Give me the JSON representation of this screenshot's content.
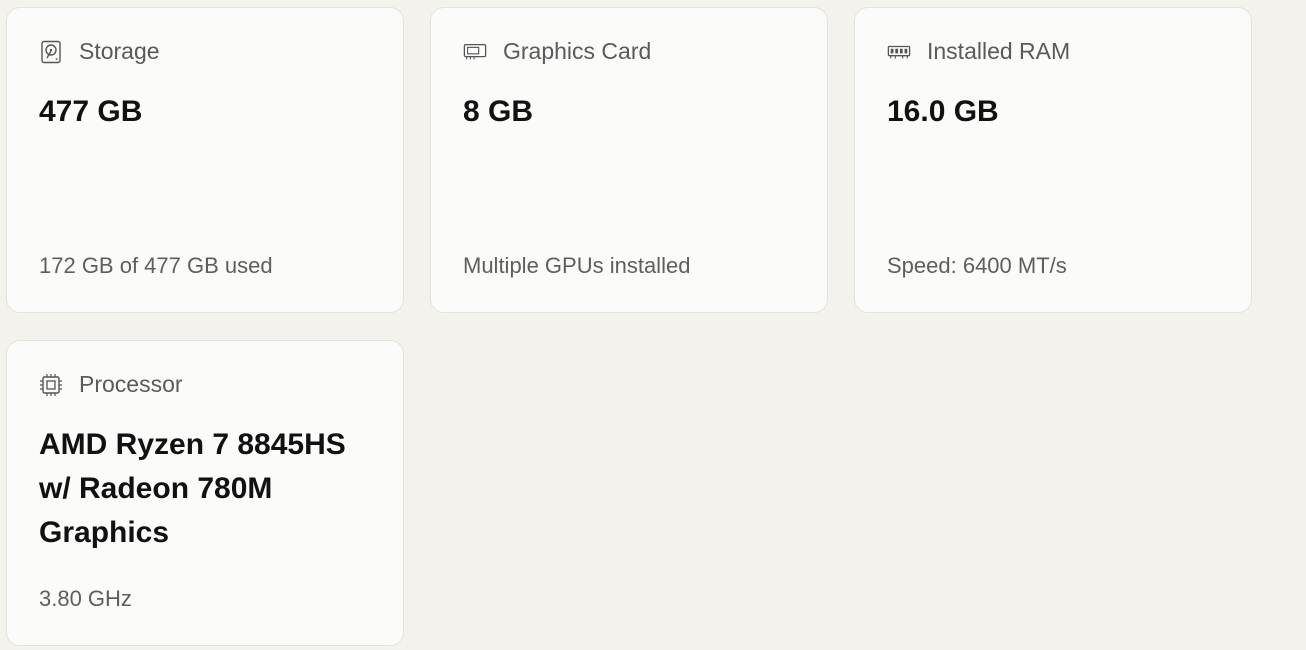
{
  "cards": [
    {
      "icon": "hard-drive-icon",
      "title": "Storage",
      "value": "477 GB",
      "detail": "172 GB of 477 GB used"
    },
    {
      "icon": "graphics-card-icon",
      "title": "Graphics Card",
      "value": "8 GB",
      "detail": "Multiple GPUs installed"
    },
    {
      "icon": "memory-icon",
      "title": "Installed RAM",
      "value": "16.0 GB",
      "detail": "Speed: 6400 MT/s"
    },
    {
      "icon": "processor-icon",
      "title": "Processor",
      "value": "AMD Ryzen 7 8845HS w/ Radeon 780M Graphics",
      "detail": "3.80 GHz"
    }
  ]
}
